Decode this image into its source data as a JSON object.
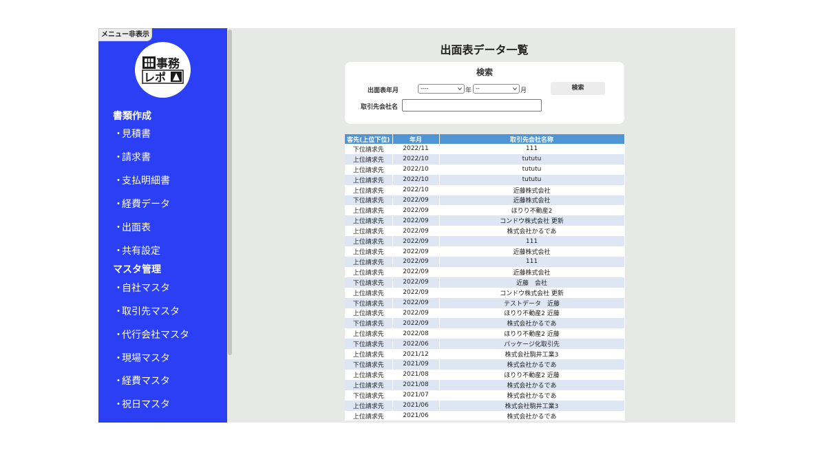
{
  "sidebar": {
    "toggle_label": "メニュー非表示",
    "logo_text": "事務レポ",
    "sections": [
      {
        "title": "書類作成",
        "items": [
          "見積書",
          "請求書",
          "支払明細書",
          "経費データ",
          "出面表",
          "共有設定"
        ]
      },
      {
        "title": "マスタ管理",
        "items": [
          "自社マスタ",
          "取引先マスタ",
          "代行会社マスタ",
          "現場マスタ",
          "経費マスタ",
          "祝日マスタ"
        ]
      }
    ],
    "bullet": "・"
  },
  "main": {
    "title": "出面表データ一覧",
    "search": {
      "title": "検索",
      "month_label": "出面表年月",
      "year_value": "----",
      "year_suffix": "年",
      "month_value": "--",
      "month_suffix": "月",
      "button_label": "検索",
      "company_label": "取引先会社名",
      "company_value": ""
    },
    "table": {
      "headers": [
        "客先(上位下位)",
        "年月",
        "取引先会社名称"
      ],
      "rows": [
        [
          "下位請求先",
          "2022/11",
          "111"
        ],
        [
          "上位請求先",
          "2022/10",
          "tututu"
        ],
        [
          "上位請求先",
          "2022/10",
          "tututu"
        ],
        [
          "上位請求先",
          "2022/10",
          "tututu"
        ],
        [
          "上位請求先",
          "2022/10",
          "近藤株式会社"
        ],
        [
          "下位請求先",
          "2022/09",
          "近藤株式会社"
        ],
        [
          "上位請求先",
          "2022/09",
          "ほりり不動産2"
        ],
        [
          "上位請求先",
          "2022/09",
          "コンドウ株式会社 更新"
        ],
        [
          "上位請求先",
          "2022/09",
          "株式会社かるであ"
        ],
        [
          "上位請求先",
          "2022/09",
          "111"
        ],
        [
          "上位請求先",
          "2022/09",
          "近藤株式会社"
        ],
        [
          "上位請求先",
          "2022/09",
          "111"
        ],
        [
          "上位請求先",
          "2022/09",
          "近藤株式会社"
        ],
        [
          "下位請求先",
          "2022/09",
          "近藤　会社"
        ],
        [
          "上位請求先",
          "2022/09",
          "コンドウ株式会社 更新"
        ],
        [
          "下位請求先",
          "2022/09",
          "テストデータ　近藤"
        ],
        [
          "上位請求先",
          "2022/09",
          "ほりり不動産2 近藤"
        ],
        [
          "下位請求先",
          "2022/09",
          "株式会社かるであ"
        ],
        [
          "上位請求先",
          "2022/08",
          "ほりり不動産2 近藤"
        ],
        [
          "下位請求先",
          "2022/06",
          "パッケージ化取引先"
        ],
        [
          "上位請求先",
          "2021/12",
          "株式会社駒井工業3"
        ],
        [
          "下位請求先",
          "2021/09",
          "株式会社かるであ"
        ],
        [
          "上位請求先",
          "2021/08",
          "ほりり不動産2 近藤"
        ],
        [
          "上位請求先",
          "2021/08",
          "株式会社かるであ"
        ],
        [
          "下位請求先",
          "2021/07",
          "株式会社かるであ"
        ],
        [
          "上位請求先",
          "2021/06",
          "株式会社駒井工業3"
        ],
        [
          "上位請求先",
          "2021/06",
          "株式会社かるであ"
        ]
      ]
    }
  },
  "colors": {
    "sidebar": "#2b3ff5",
    "table_header": "#4f94d5",
    "row_stripe": "#dde6f2",
    "main_bg": "#e7e9e6"
  }
}
